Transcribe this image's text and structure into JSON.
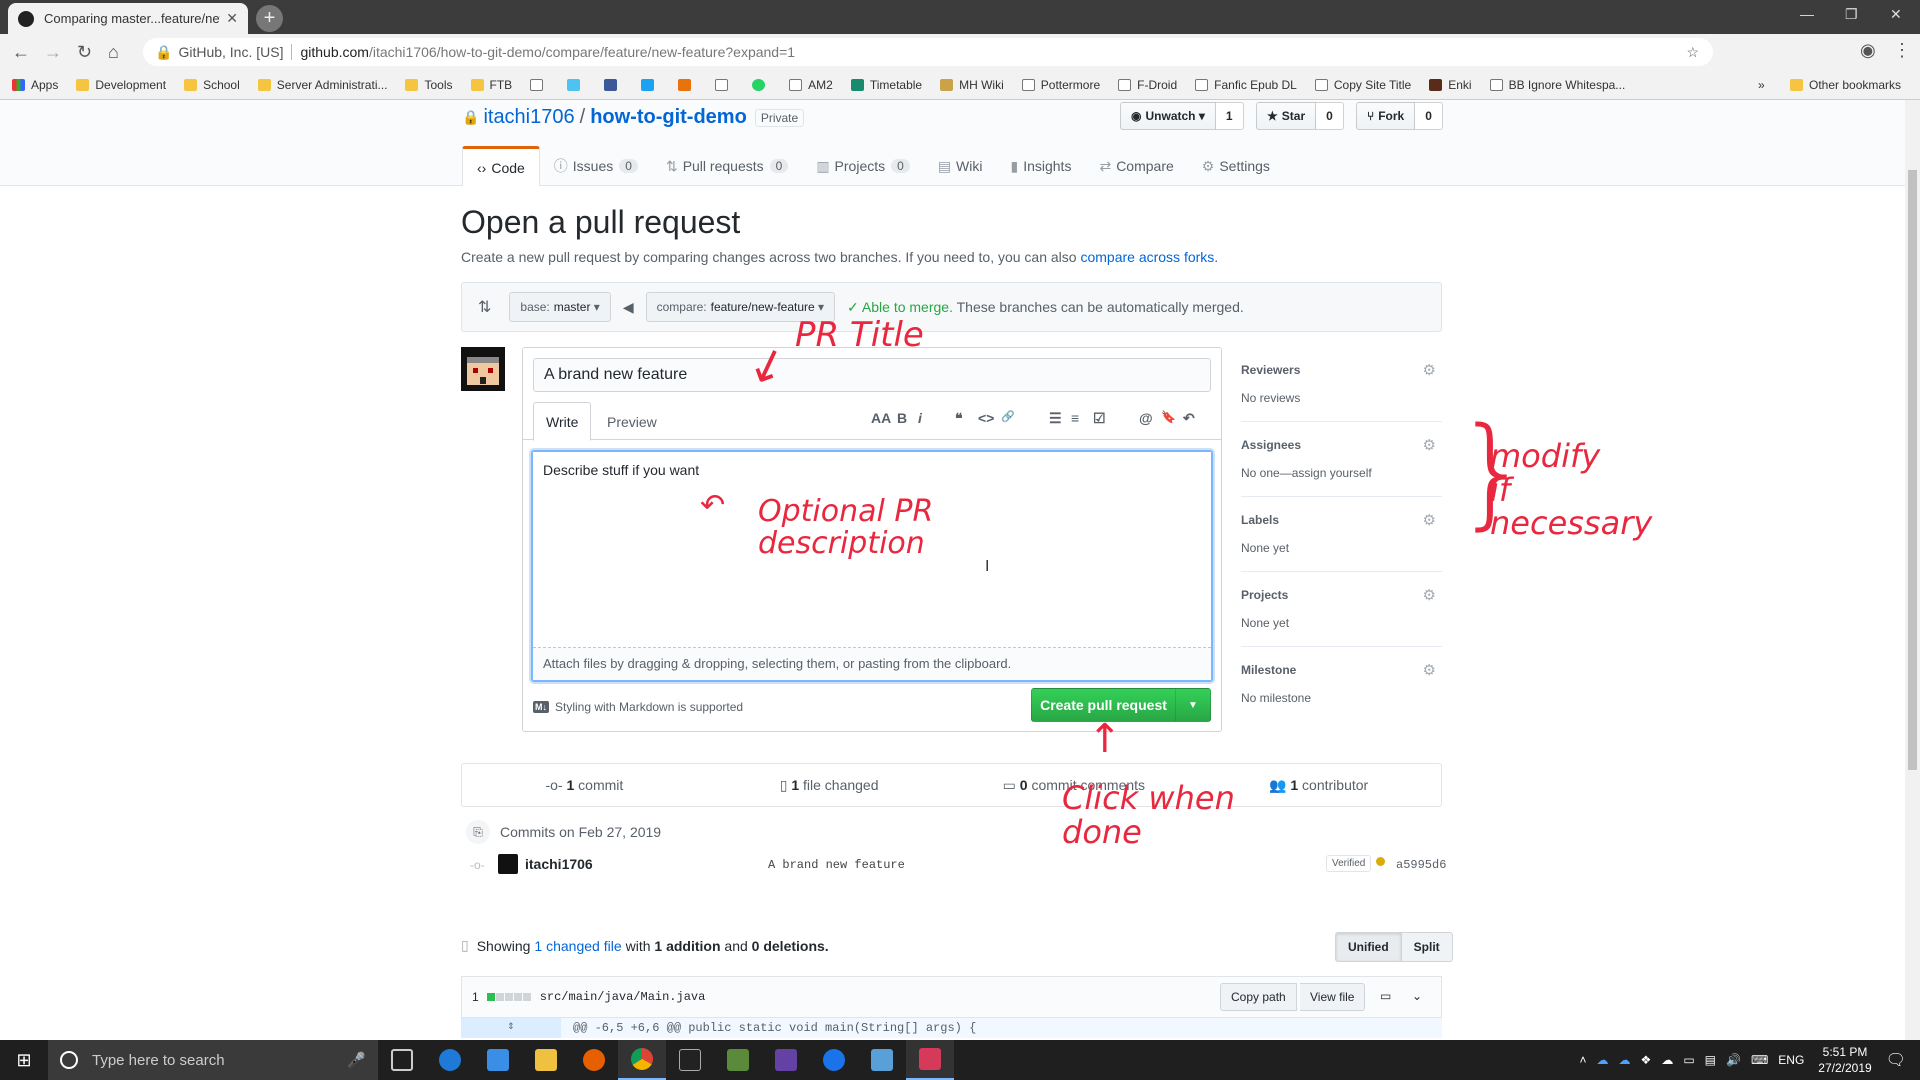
{
  "browser": {
    "tab_title": "Comparing master...feature/new-",
    "security_label": "GitHub, Inc. [US]",
    "url_domain": "github.com",
    "url_path": "/itachi1706/how-to-git-demo/compare/feature/new-feature?expand=1",
    "bookmarks": [
      "Apps",
      "Development",
      "School",
      "Server Administrati...",
      "Tools",
      "FTB",
      "",
      "",
      "",
      "",
      "",
      "",
      "",
      "",
      "AM2",
      "Timetable",
      "MH Wiki",
      "Pottermore",
      "F-Droid",
      "Fanfic Epub DL",
      "Copy Site Title",
      "Enki",
      "BB Ignore Whitespa..."
    ],
    "other_bookmarks": "Other bookmarks"
  },
  "repo": {
    "owner": "itachi1706",
    "name": "how-to-git-demo",
    "visibility": "Private",
    "watch_label": "Unwatch",
    "watch_count": "1",
    "star_label": "Star",
    "star_count": "0",
    "fork_label": "Fork",
    "fork_count": "0",
    "nav": [
      {
        "label": "Code"
      },
      {
        "label": "Issues",
        "count": "0"
      },
      {
        "label": "Pull requests",
        "count": "0"
      },
      {
        "label": "Projects",
        "count": "0"
      },
      {
        "label": "Wiki"
      },
      {
        "label": "Insights"
      },
      {
        "label": "Compare"
      },
      {
        "label": "Settings"
      }
    ]
  },
  "page": {
    "title": "Open a pull request",
    "subtitle": "Create a new pull request by comparing changes across two branches. If you need to, you can also",
    "subtitle_link": "compare across forks.",
    "base_prefix": "base:",
    "base_branch": "master",
    "compare_prefix": "compare:",
    "compare_branch": "feature/new-feature",
    "merge_status": "Able to merge.",
    "merge_detail": "These branches can be automatically merged."
  },
  "composer": {
    "title_value": "A brand new feature",
    "tab_write": "Write",
    "tab_preview": "Preview",
    "toolbar": [
      "AA",
      "B",
      "i",
      "❝",
      "<>",
      "🔗",
      "☰",
      "≡",
      "☑",
      "@",
      "🔖",
      "↶"
    ],
    "body_value": "Describe stuff if you want",
    "attach_text": "Attach files by dragging & dropping, selecting them, or pasting from the clipboard.",
    "markdown_note": "Styling with Markdown is supported",
    "create_button": "Create pull request"
  },
  "sidebar": [
    {
      "heading": "Reviewers",
      "value": "No reviews"
    },
    {
      "heading": "Assignees",
      "value": "No one—assign yourself"
    },
    {
      "heading": "Labels",
      "value": "None yet"
    },
    {
      "heading": "Projects",
      "value": "None yet"
    },
    {
      "heading": "Milestone",
      "value": "No milestone"
    }
  ],
  "summary": {
    "commits": "1",
    "commits_label": "commit",
    "files": "1",
    "files_label": "file changed",
    "comments": "0",
    "comments_label": "commit comments",
    "contributors": "1",
    "contributors_label": "contributor"
  },
  "commits": {
    "date_heading": "Commits on Feb 27, 2019",
    "items": [
      {
        "author": "itachi1706",
        "message": "A brand new feature",
        "verified": "Verified",
        "sha": "a5995d6"
      }
    ]
  },
  "diff": {
    "showing_prefix": "Showing",
    "changed_files": "1 changed file",
    "showing_mid": "with",
    "additions": "1 addition",
    "and": "and",
    "deletions": "0 deletions.",
    "unified": "Unified",
    "split": "Split",
    "file_count": "1",
    "file_path": "src/main/java/Main.java",
    "copy_path": "Copy path",
    "view_file": "View file",
    "hunk_header": "@@ -6,5 +6,6 @@ public static void main(String[] args) {"
  },
  "annotations": {
    "pr_title": "PR Title",
    "description": "Optional PR\ndescription",
    "modify": "modify\nif\nnecessary",
    "click": "Click when\ndone"
  },
  "taskbar": {
    "search_placeholder": "Type here to search",
    "lang": "ENG",
    "time": "5:51 PM",
    "date": "27/2/2019"
  }
}
